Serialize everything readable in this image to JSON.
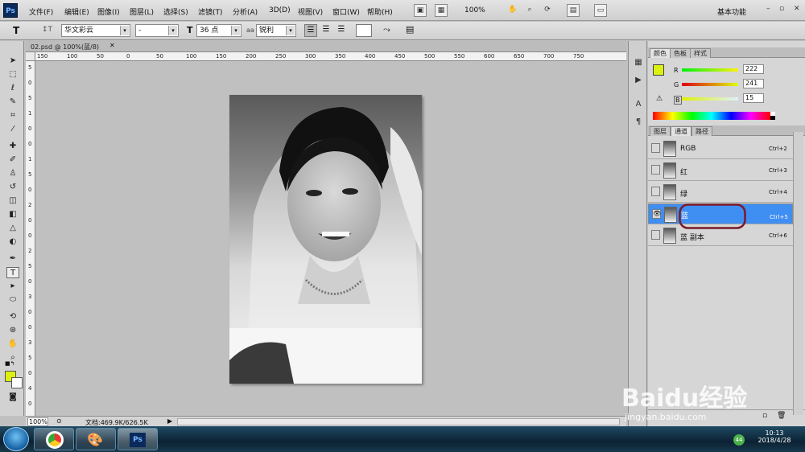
{
  "app": {
    "logo": "Ps",
    "document_tab": "02.psd @ 100%(蓝/8)"
  },
  "menu": [
    "文件(F)",
    "编辑(E)",
    "图像(I)",
    "图层(L)",
    "选择(S)",
    "滤镜(T)",
    "分析(A)",
    "3D(D)",
    "视图(V)",
    "窗口(W)",
    "帮助(H)"
  ],
  "toolbar": {
    "zoom": "100%",
    "workspace": "基本功能"
  },
  "options": {
    "tool_icon": "T",
    "font_family": "华文彩云",
    "font_style": "-",
    "size_icon": "T",
    "font_size": "36 点",
    "aa_icon": "aa",
    "antialias": "锐利"
  },
  "ruler_top_labels": [
    "150",
    "100",
    "50",
    "0",
    "50",
    "100",
    "150",
    "200",
    "250",
    "300",
    "350",
    "400",
    "450",
    "500",
    "550",
    "600",
    "650",
    "700",
    "750"
  ],
  "ruler_left_labels": [
    "5",
    "0",
    "5",
    "1",
    "0",
    "0",
    "1",
    "5",
    "0",
    "2",
    "0",
    "0",
    "2",
    "5",
    "0",
    "3",
    "0",
    "0",
    "3",
    "5",
    "0",
    "4",
    "0"
  ],
  "status": {
    "zoom": "100%",
    "doc": "文档:469.9K/626.5K"
  },
  "color_panel": {
    "tabs": [
      "颜色",
      "色板",
      "样式"
    ],
    "fg_color": "#dcf10f",
    "bg_color": "#ffffff",
    "r_label": "R",
    "r_value": "222",
    "g_label": "G",
    "g_value": "241",
    "b_label": "B",
    "b_value": "15"
  },
  "channels_panel": {
    "tabs": [
      "图层",
      "通道",
      "路径"
    ],
    "rows": [
      {
        "name": "RGB",
        "shortcut": "Ctrl+2",
        "visible": false,
        "selected": false
      },
      {
        "name": "红",
        "shortcut": "Ctrl+3",
        "visible": false,
        "selected": false
      },
      {
        "name": "绿",
        "shortcut": "Ctrl+4",
        "visible": false,
        "selected": false
      },
      {
        "name": "蓝",
        "shortcut": "Ctrl+5",
        "visible": true,
        "selected": true
      },
      {
        "name": "蓝 副本",
        "shortcut": "Ctrl+6",
        "visible": false,
        "selected": false
      }
    ],
    "eye_icon": "eye-icon",
    "highlight_color": "#7b1a2a"
  },
  "watermark": {
    "brand": "Baidu经验",
    "url": "jingyan.baidu.com"
  },
  "taskbar": {
    "time": "10:13",
    "date": "2018/4/28",
    "badge": "44"
  },
  "colors": {
    "selection": "#3f8ef2",
    "canvas_bg": "#c0c0c0",
    "fg": "#dcf10f"
  }
}
